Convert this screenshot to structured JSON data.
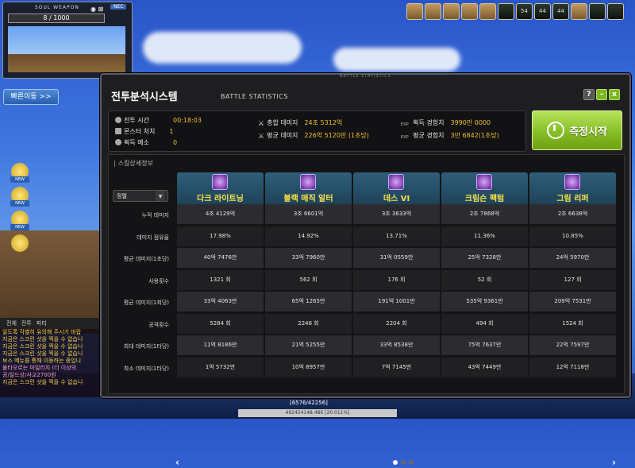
{
  "minimap": {
    "title": "SOUL WEAPON",
    "gauge": "8 / 1000",
    "badge": "NEC"
  },
  "quick_move": {
    "label": "빠른이동 >>"
  },
  "top_bar": {
    "icons": [
      "54",
      "44",
      "44"
    ]
  },
  "chat": {
    "tabs": [
      "전체",
      "전투",
      "파티"
    ],
    "lines": [
      "알도록 각별히 유의해 주시기 바랍",
      "지금은 스크린 샷을 찍을 수 없습니",
      "지금은 스크린 샷을 찍을 수 없습니",
      "지금은 스크린 샷을 찍을 수 없습니",
      "보스 메뉴를 통해 이동하는 중입니",
      "불타오르는 마일리지 (더 이상의",
      "공/일드상/사교2700원",
      "지금은 스크린 샷을 찍을 수 없습니"
    ]
  },
  "bottom": {
    "exp_text": "492454148.486 [20.011%]",
    "hp_text": "[6576/42256]"
  },
  "window": {
    "caption": "BATTLE STATISTICS",
    "title_ko": "전투분석시스템",
    "title_en": "BATTLE STATISTICS",
    "buttons": {
      "help": "?",
      "minimize": "–",
      "close": "x"
    }
  },
  "stats": {
    "battle_time": {
      "label": "전투 시간",
      "value": "00:18:03"
    },
    "monsters": {
      "label": "몬스터 처치",
      "value": "1"
    },
    "meso": {
      "label": "획득 메소",
      "value": "0"
    },
    "total_damage": {
      "label": "총합 데미지",
      "value": "24조 5312억"
    },
    "avg_damage": {
      "label": "평균 데미지",
      "value": "226억 5120만 (1초당)"
    },
    "exp_gain": {
      "prefix": "EXP",
      "label": "획득 경험치",
      "value": "3990만 0000"
    },
    "exp_avg": {
      "prefix": "EXP",
      "label": "평균 경험치",
      "value": "3만 6842(1초당)"
    }
  },
  "measure_button": {
    "label": "측정시작"
  },
  "detail": {
    "title": "스킬상세정보",
    "sort": "정렬",
    "row_labels": [
      "누적 데미지",
      "데미지 점유율",
      "평균 데미지(1초당)",
      "사용횟수",
      "평균 데미지(1회당)",
      "공격횟수",
      "최대 데미지(1타당)",
      "최소 데미지(1타당)"
    ],
    "skills": [
      {
        "name": "다크 라이트닝",
        "values": [
          "4조 4129억",
          "17.98%",
          "40억 7476만",
          "1321 회",
          "33억 4063만",
          "5284 회",
          "11억 8186만",
          "1억 5732만"
        ]
      },
      {
        "name": "블랙 매직 알터",
        "values": [
          "3조 6601억",
          "14.92%",
          "33억 7960만",
          "562 회",
          "65억 1265만",
          "2248 회",
          "21억 5255만",
          "10억 8957만"
        ]
      },
      {
        "name": "데스 VI",
        "values": [
          "3조 3633억",
          "13.71%",
          "31억 0559만",
          "176 회",
          "191억 1001만",
          "2204 회",
          "33억 8538만",
          "7억 7145만"
        ]
      },
      {
        "name": "크림슨 팩텀",
        "values": [
          "2조 7868억",
          "11.36%",
          "25억 7328만",
          "52 회",
          "535억 9361만",
          "494 회",
          "75억 7637만",
          "43억 7449만"
        ]
      },
      {
        "name": "그림 리퍼",
        "values": [
          "2조 6638억",
          "10.85%",
          "24억 5970만",
          "127 회",
          "209억 7531만",
          "1524 회",
          "22억 7597만",
          "12억 7118만"
        ]
      }
    ],
    "nav": {
      "prev": "‹",
      "next": "›"
    }
  }
}
